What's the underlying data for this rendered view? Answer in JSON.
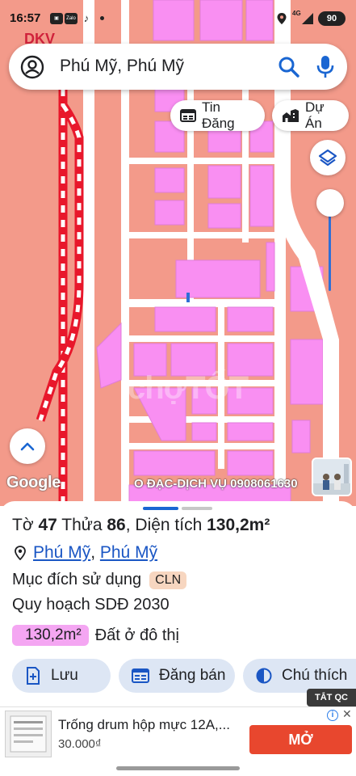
{
  "status_bar": {
    "time": "16:57",
    "app_badge": "Zalo",
    "network": "4G",
    "battery": "90"
  },
  "search": {
    "query": "Phú Mỹ, Phú Mỹ"
  },
  "map_chips": {
    "listings_label": "Tin Đăng",
    "projects_label": "Dự Án"
  },
  "map": {
    "corner_label": "DKV",
    "attribution": "Google",
    "watermark": "O ĐẠC-DỊCH VỤ 0908061630",
    "overlay_logo": "chợTỐT",
    "colors": {
      "residential": "#f98ff2",
      "agricultural": "#f39a8a",
      "road": "#ffffff",
      "rail": "#e8172b",
      "accent": "#2f6fd6"
    }
  },
  "parcel": {
    "sheet_prefix": "Tờ",
    "sheet_no": "47",
    "plot_prefix": "Thửa",
    "plot_no": "86",
    "area_prefix": ", Diện tích",
    "area": "130,2m²",
    "ward": "Phú Mỹ",
    "separator": ", ",
    "town": "Phú Mỹ",
    "purpose_label": "Mục đích sử dụng",
    "purpose_code": "CLN",
    "plan_label": "Quy hoạch SDĐ 2030",
    "plan_area": "130,2m²",
    "plan_type": "Đất ở đô thị"
  },
  "actions": {
    "save": "Lưu",
    "post": "Đăng bán",
    "legend": "Chú thích"
  },
  "ad": {
    "hide_label": "TẮT QC",
    "title": "Trống drum hộp mực 12A,...",
    "price": "30.000₫",
    "cta": "MỞ"
  }
}
